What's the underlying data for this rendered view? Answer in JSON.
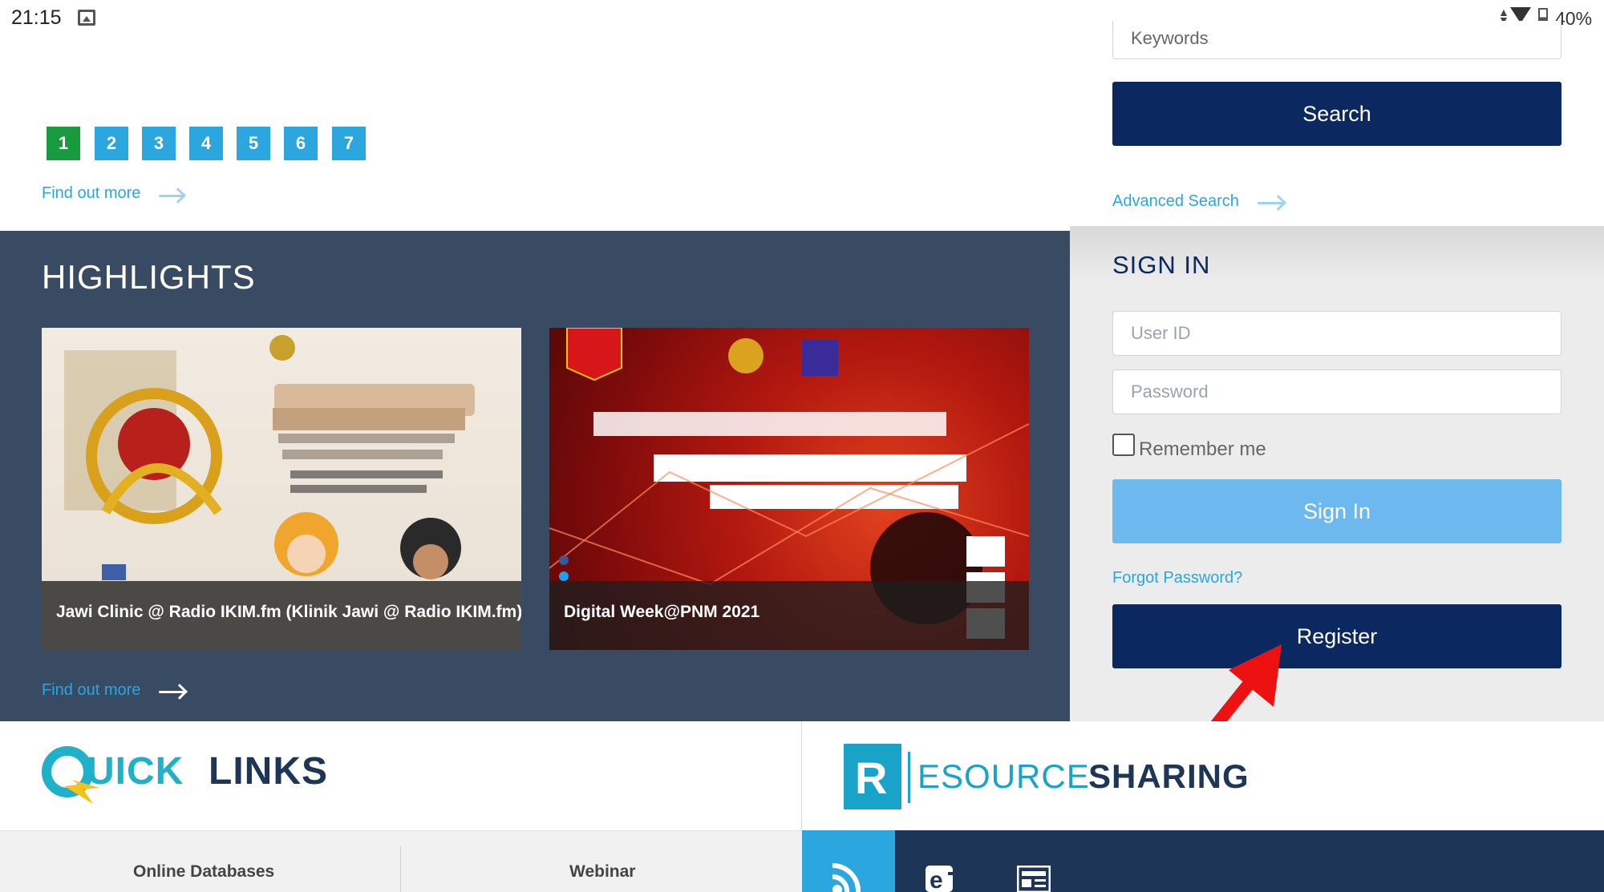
{
  "status_bar": {
    "time": "21:15",
    "battery": "40%"
  },
  "pagination": {
    "pages": [
      "1",
      "2",
      "3",
      "4",
      "5",
      "6",
      "7"
    ],
    "active": "1"
  },
  "news": {
    "find_more": "Find out more"
  },
  "highlights": {
    "title": "HIGHLIGHTS",
    "find_more": "Find out more",
    "cards": [
      {
        "caption": "Jawi Clinic @ Radio IKIM.fm (Klinik Jawi @ Radio IKIM.fm)"
      },
      {
        "caption": "Digital Week@PNM 2021"
      }
    ]
  },
  "search": {
    "keywords_placeholder": "Keywords",
    "search_button": "Search",
    "advanced_search": "Advanced Search"
  },
  "signin": {
    "title": "SIGN IN",
    "user_id_placeholder": "User ID",
    "password_placeholder": "Password",
    "remember_me": "Remember me",
    "signin_button": "Sign In",
    "forgot_password": "Forgot Password?",
    "register_button": "Register"
  },
  "quick_links": {
    "logo_letter": "Q",
    "logo_rest": "UICK",
    "logo_links": "LINKS"
  },
  "resource_sharing": {
    "logo_letter": "R",
    "logo_esource": "ESOURCE",
    "logo_sharing": "SHARING"
  },
  "bottom_tabs": {
    "online_databases": "Online Databases",
    "webinar": "Webinar"
  },
  "colors": {
    "navy": "#0b2860",
    "accent_blue": "#2ba6de",
    "active_green": "#1a9a3f",
    "highlights_bg": "#394a63",
    "signin_light_blue": "#6cb8ef",
    "annotation_red": "#ee1111"
  }
}
